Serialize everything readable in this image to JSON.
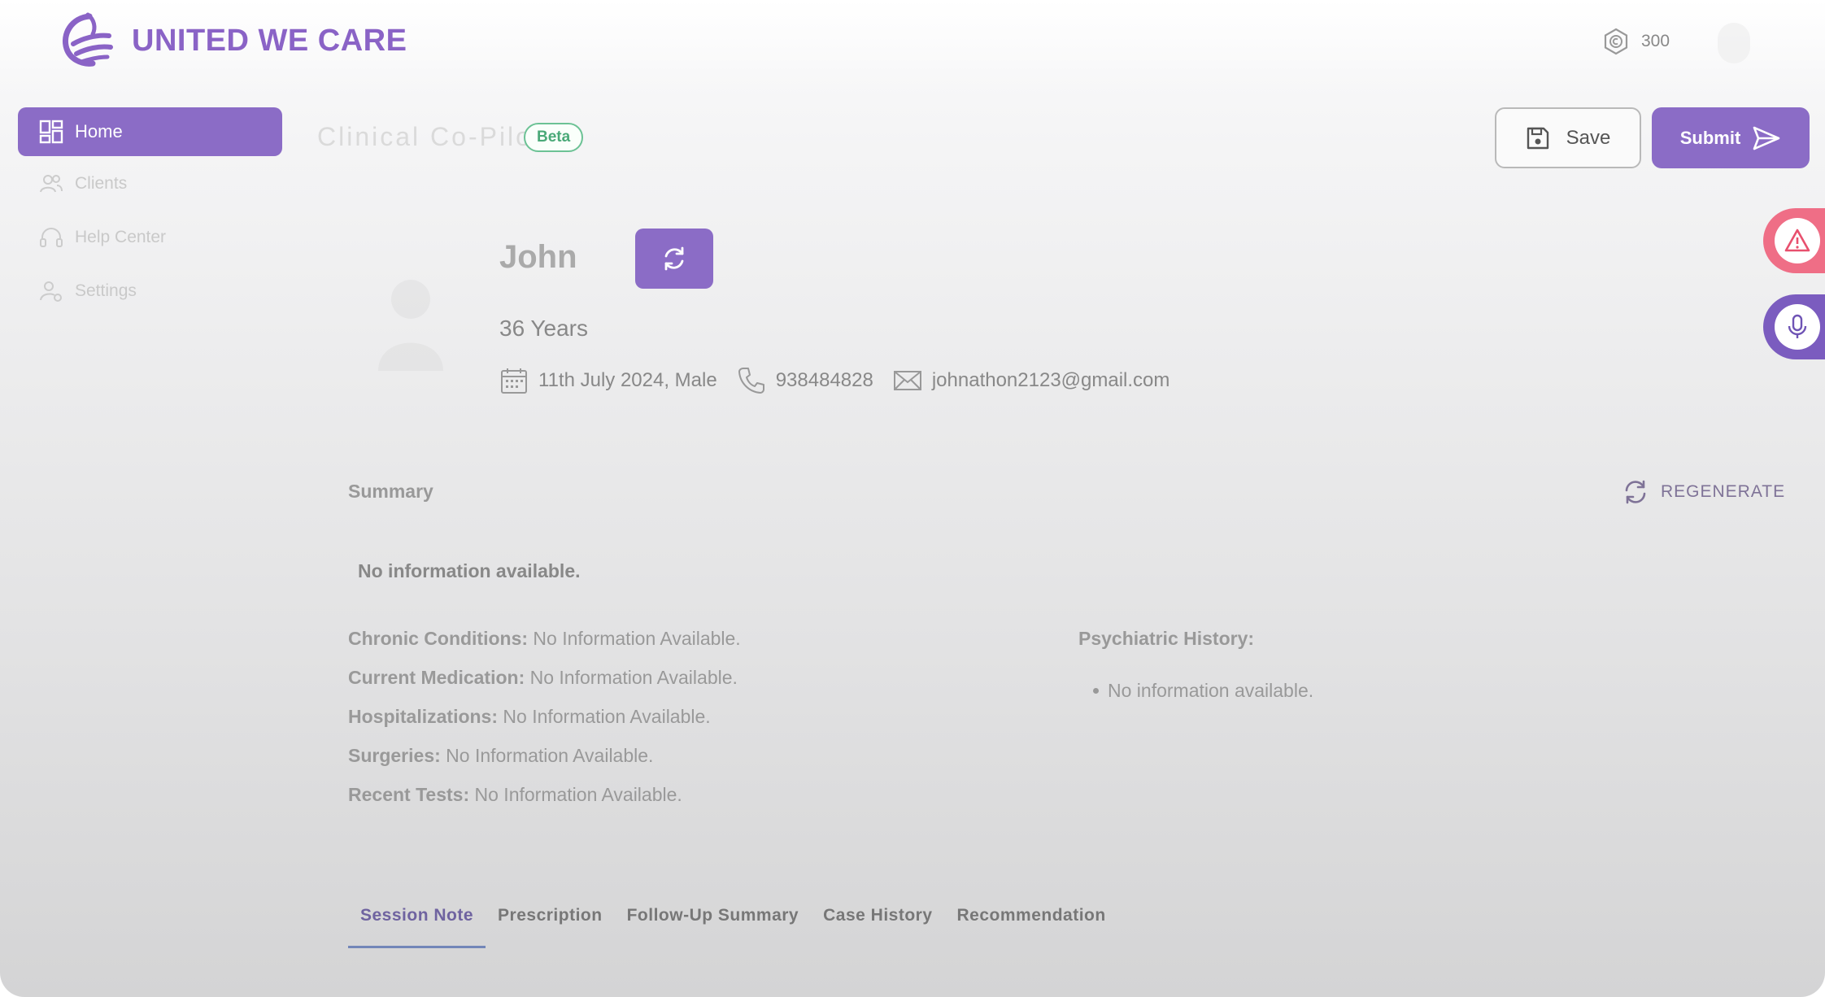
{
  "brand": {
    "name": "UNITED WE CARE",
    "accent": "#8b6cc6"
  },
  "header": {
    "coins": "300"
  },
  "sidebar": {
    "items": [
      {
        "label": "Home",
        "icon": "dashboard-icon",
        "active": true
      },
      {
        "label": "Clients",
        "icon": "users-icon",
        "active": false
      },
      {
        "label": "Help Center",
        "icon": "headset-icon",
        "active": false
      },
      {
        "label": "Settings",
        "icon": "user-settings-icon",
        "active": false
      }
    ]
  },
  "toolbar": {
    "title": "Clinical Co-Pilot",
    "badge": "Beta",
    "save_label": "Save",
    "submit_label": "Submit"
  },
  "client": {
    "name": "John",
    "age": "36 Years",
    "dob_gender": "11th July 2024, Male",
    "phone": "938484828",
    "email": "johnathon2123@gmail.com"
  },
  "summary": {
    "label": "Summary",
    "regenerate_label": "REGENERATE",
    "text": "No information available.",
    "facts": [
      {
        "key": "Chronic Conditions:",
        "value": " No Information Available."
      },
      {
        "key": "Current Medication:",
        "value": " No Information Available."
      },
      {
        "key": "Hospitalizations:",
        "value": " No Information Available."
      },
      {
        "key": "Surgeries:",
        "value": " No Information Available."
      },
      {
        "key": "Recent Tests:",
        "value": " No Information Available."
      }
    ],
    "psychiatric_label": "Psychiatric History:",
    "psychiatric_items": [
      "No information available."
    ]
  },
  "tabs": [
    {
      "label": "Session Note",
      "active": true
    },
    {
      "label": "Prescription",
      "active": false
    },
    {
      "label": "Follow-Up Summary",
      "active": false
    },
    {
      "label": "Case History",
      "active": false
    },
    {
      "label": "Recommendation",
      "active": false
    }
  ]
}
